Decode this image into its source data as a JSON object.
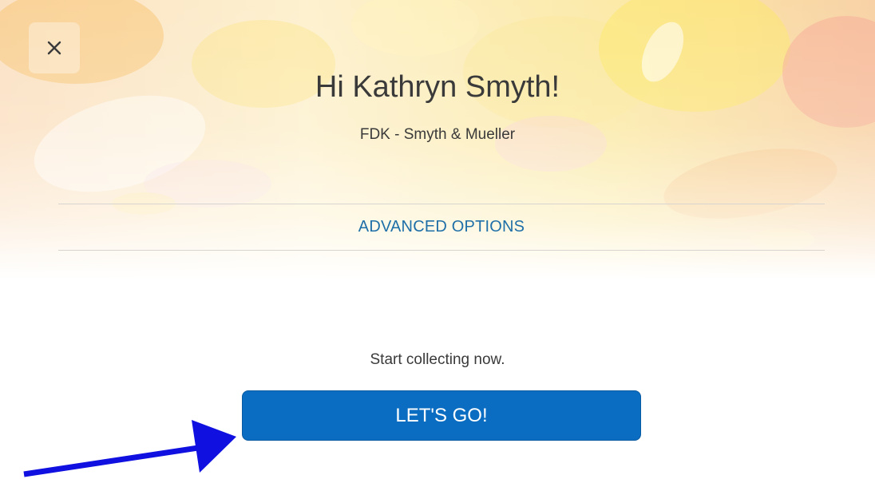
{
  "header": {
    "greeting": "Hi Kathryn Smyth!",
    "company": "FDK - Smyth & Mueller",
    "close_icon": "close-icon"
  },
  "advanced": {
    "label": "ADVANCED OPTIONS"
  },
  "cta": {
    "prompt": "Start collecting now.",
    "button_label": "LET'S GO!"
  },
  "annotation": {
    "icon": "arrow-icon"
  },
  "colors": {
    "accent": "#0a6dc2",
    "link": "#1f6fa8",
    "arrow": "#1010e0",
    "text": "#3a3a3a"
  }
}
